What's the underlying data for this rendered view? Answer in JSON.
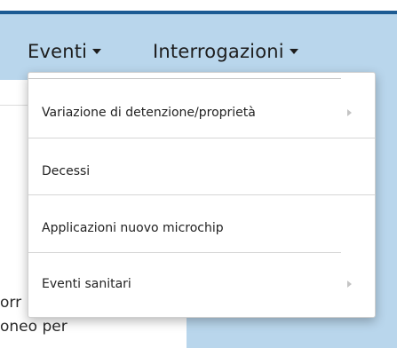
{
  "navbar": {
    "items": [
      {
        "label": "Eventi",
        "icon": "caret-down-icon"
      },
      {
        "label": "Interrogazioni",
        "icon": "caret-down-icon"
      }
    ]
  },
  "dropdown": {
    "items": [
      {
        "label": "Variazione di detenzione/proprietà",
        "has_submenu": true
      },
      {
        "label": "Decessi",
        "has_submenu": false
      },
      {
        "label": "Applicazioni nuovo microchip",
        "has_submenu": false
      },
      {
        "label": "Eventi sanitari",
        "has_submenu": true
      }
    ]
  },
  "background": {
    "text_lines": [
      "orr",
      "oneo per"
    ]
  },
  "colors": {
    "navbar_bg": "#b9d6ec",
    "navbar_border": "#1c5b93",
    "menu_bg": "#ffffff",
    "text": "#222222"
  }
}
